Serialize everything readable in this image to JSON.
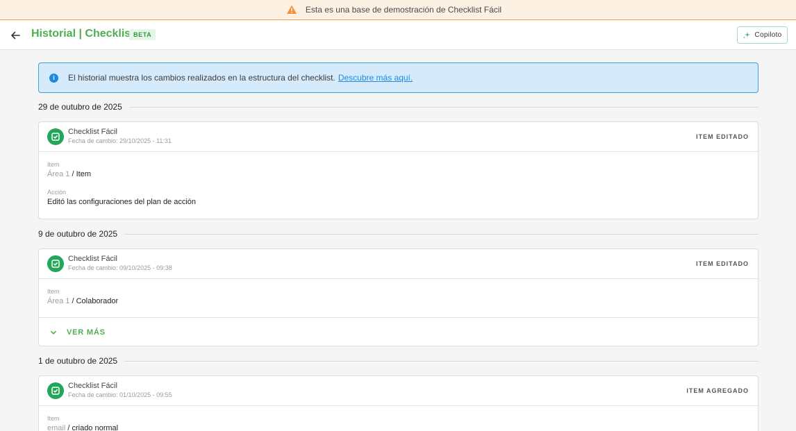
{
  "banner": {
    "text": "Esta es una base de demostración de Checklist Fácil",
    "icon": "warning-icon"
  },
  "header": {
    "title": "Historial | Checklist",
    "badge": "BETA",
    "copilot_label": "Copiloto"
  },
  "info": {
    "text": "El historial muestra los cambios realizados en la estructura del checklist.",
    "link": "Descubre más aquí."
  },
  "groups": [
    {
      "date": "29 de outubro de 2025",
      "card": {
        "company": "Checklist Fácil",
        "change_date": "Fecha de cambio: 29/10/2025 - 11:31",
        "action": "ITEM EDITADO",
        "item_label": "Item",
        "item_area": "Área 1",
        "item_sep": " / ",
        "item_name": "Item",
        "accion_label": "Acción",
        "accion_value": "Editó las configuraciones del plan de acción"
      }
    },
    {
      "date": "9 de outubro de 2025",
      "card": {
        "company": "Checklist Fácil",
        "change_date": "Fecha de cambio: 09/10/2025 - 09:38",
        "action": "ITEM EDITADO",
        "item_label": "Item",
        "item_area": "Área 1",
        "item_sep": " / ",
        "item_name": "Colaborador",
        "ver_mas": "VER MÁS"
      }
    },
    {
      "date": "1 de outubro de 2025",
      "card": {
        "company": "Checklist Fácil",
        "change_date": "Fecha de cambio: 01/10/2025 - 09:55",
        "action": "ITEM AGREGADO",
        "item_label": "Item",
        "item_area": "email",
        "item_sep": " / ",
        "item_name": "criado normal"
      }
    }
  ],
  "colors": {
    "brand_green": "#4caf50",
    "avatar_green": "#23a55a",
    "info_bg": "#d5eafb",
    "info_border": "#3aa6d8",
    "banner_bg": "#fdf1e4",
    "banner_border": "#f0a04b"
  }
}
